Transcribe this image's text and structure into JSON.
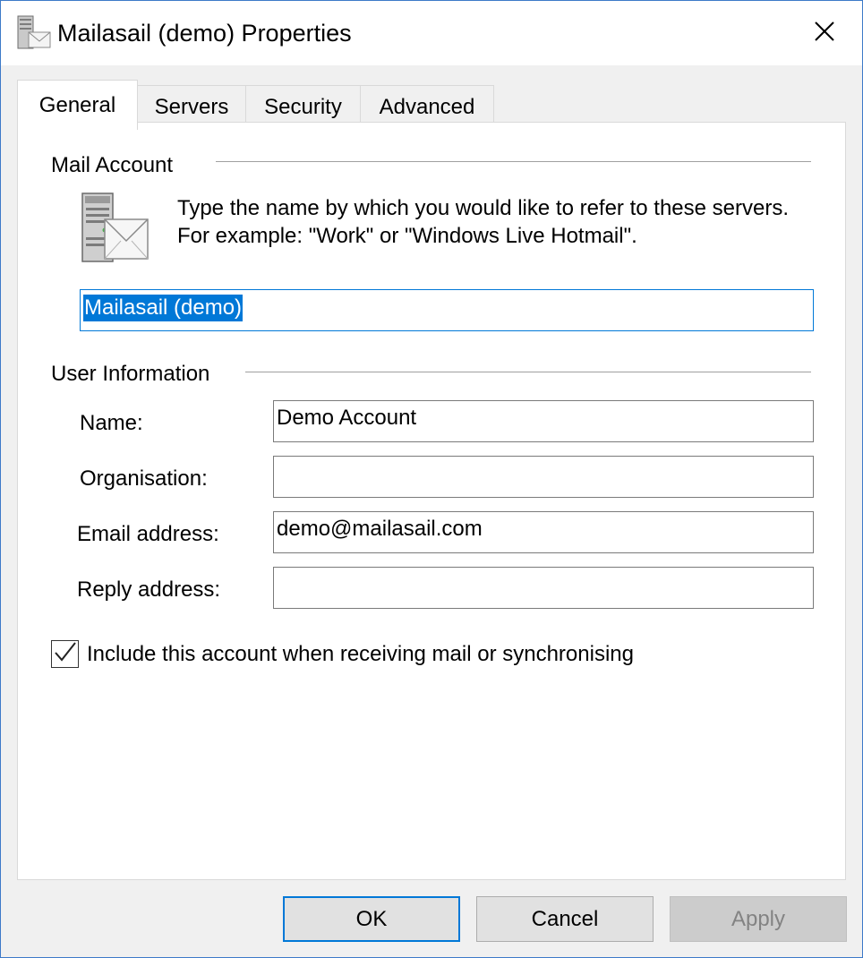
{
  "window": {
    "title": "Mailasail (demo) Properties"
  },
  "tabs": [
    {
      "label": "General",
      "active": true
    },
    {
      "label": "Servers",
      "active": false
    },
    {
      "label": "Security",
      "active": false
    },
    {
      "label": "Advanced",
      "active": false
    }
  ],
  "mail_account": {
    "group_label": "Mail Account",
    "description": "Type the name by which you would like to refer to these servers. For example: \"Work\" or \"Windows Live Hotmail\".",
    "account_name_value": "Mailasail (demo)",
    "account_name_selected": true
  },
  "user_information": {
    "group_label": "User Information",
    "name_label": "Name:",
    "name_value": "Demo Account",
    "organisation_label": "Organisation:",
    "organisation_value": "",
    "email_label": "Email address:",
    "email_value": "demo@mailasail.com",
    "reply_label": "Reply address:",
    "reply_value": ""
  },
  "include_account": {
    "label": "Include this account when receiving mail or synchronising",
    "checked": true
  },
  "buttons": {
    "ok": "OK",
    "cancel": "Cancel",
    "apply": "Apply"
  },
  "icons": {
    "title": "mail-server-icon",
    "account": "mail-server-icon",
    "close": "close-icon",
    "checkmark": "checkmark-icon"
  },
  "colors": {
    "accent": "#0078d7",
    "window_border": "#3d7ac8",
    "dialog_bg": "#f0f0f0",
    "disabled_text": "#838383"
  }
}
